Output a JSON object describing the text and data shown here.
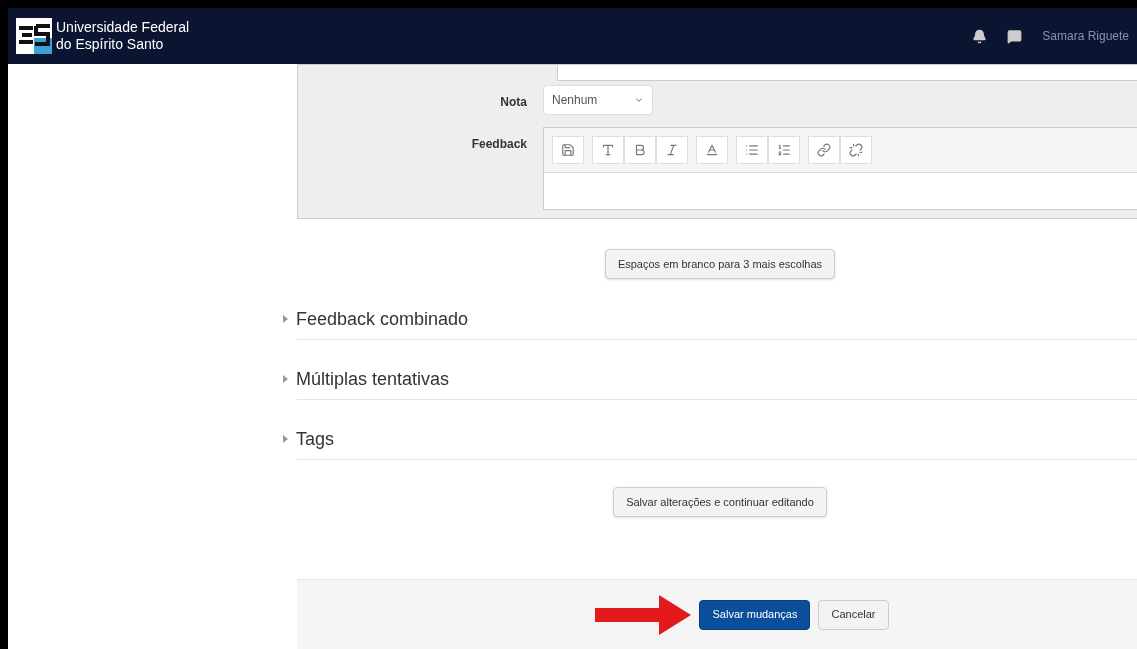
{
  "header": {
    "logo_text": "Universidade Federal do Espírito Santo",
    "user": "Samara Riguete"
  },
  "form": {
    "fields": [
      {
        "label": "Nota",
        "kind": "select",
        "value": "Nenhum"
      },
      {
        "label": "Feedback",
        "kind": "editor"
      }
    ],
    "add_button": "Espaços em branco para 3 mais escolhas"
  },
  "sections": [
    {
      "title": "Feedback combinado",
      "expanded": false
    },
    {
      "title": "Múltiplas tentativas",
      "expanded": false
    },
    {
      "title": "Tags",
      "expanded": false
    }
  ],
  "continue_button": "Salvar alterações e continuar editando",
  "footer_buttons": [
    {
      "label": "Salvar mudanças",
      "kind": "primary"
    },
    {
      "label": "Cancelar",
      "kind": "secondary"
    }
  ]
}
